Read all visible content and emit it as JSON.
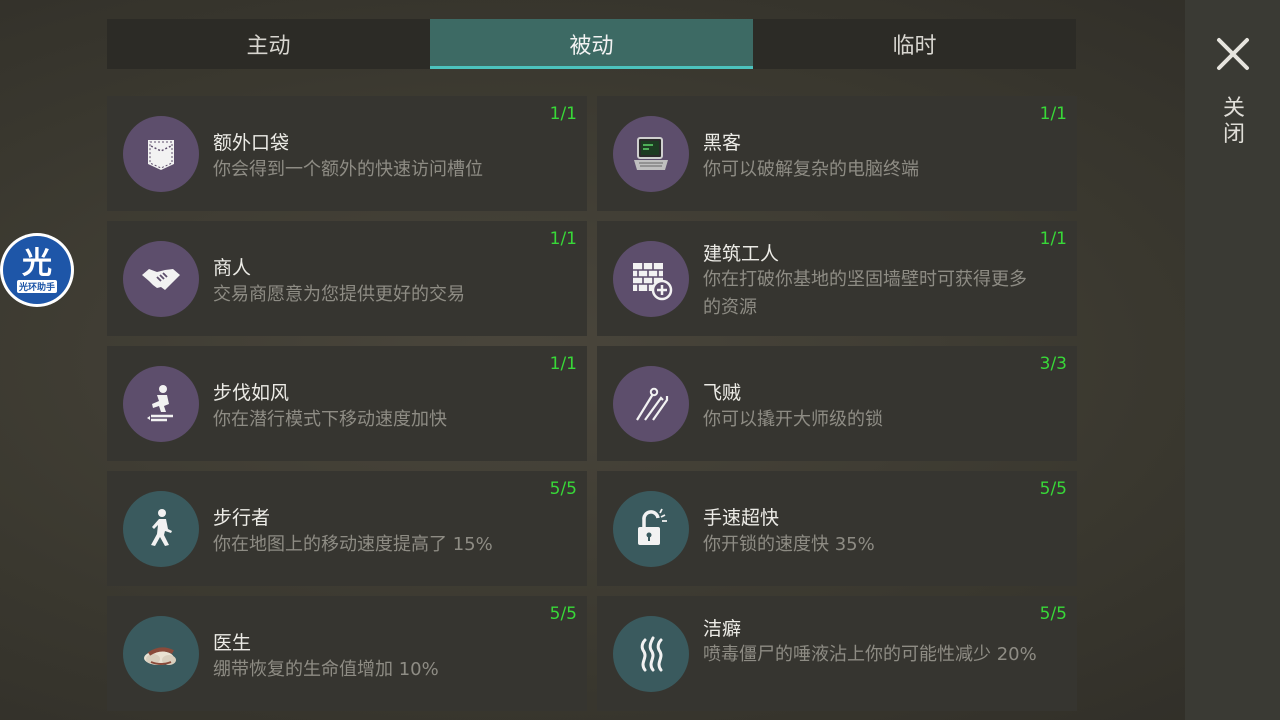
{
  "tabs": [
    {
      "label": "主动",
      "active": false
    },
    {
      "label": "被动",
      "active": true
    },
    {
      "label": "临时",
      "active": false
    }
  ],
  "close": {
    "label": "关闭",
    "icon": "close-icon"
  },
  "overlay_badge": {
    "char": "光",
    "label": "光环助手"
  },
  "colors": {
    "accent": "#4cc2bd",
    "count": "#38d838",
    "icon_purple": "#5d4e6c",
    "icon_teal": "#3a5a5e"
  },
  "skills": [
    {
      "title": "额外口袋",
      "desc": "你会得到一个额外的快速访问槽位",
      "count": "1/1",
      "icon": "pocket-icon"
    },
    {
      "title": "黑客",
      "desc": "你可以破解复杂的电脑终端",
      "count": "1/1",
      "icon": "computer-terminal-icon"
    },
    {
      "title": "商人",
      "desc": "交易商愿意为您提供更好的交易",
      "count": "1/1",
      "icon": "handshake-icon"
    },
    {
      "title": "建筑工人",
      "desc": "你在打破你基地的坚固墙壁时可获得更多的资源",
      "count": "1/1",
      "icon": "brick-wall-plus-icon"
    },
    {
      "title": "步伐如风",
      "desc": "你在潜行模式下移动速度加快",
      "count": "1/1",
      "icon": "sneak-walk-icon"
    },
    {
      "title": "飞贼",
      "desc": "你可以撬开大师级的锁",
      "count": "3/3",
      "icon": "lockpick-icon"
    },
    {
      "title": "步行者",
      "desc": "你在地图上的移动速度提高了 15%",
      "count": "5/5",
      "icon": "walker-icon"
    },
    {
      "title": "手速超快",
      "desc": "你开锁的速度快 35%",
      "count": "5/5",
      "icon": "open-padlock-icon"
    },
    {
      "title": "医生",
      "desc": "绷带恢复的生命值增加 10%",
      "count": "5/5",
      "icon": "bandage-icon"
    },
    {
      "title": "洁癖",
      "desc": "喷毒僵尸的唾液沾上你的可能性减少 20%",
      "count": "5/5",
      "icon": "fumes-icon"
    }
  ]
}
